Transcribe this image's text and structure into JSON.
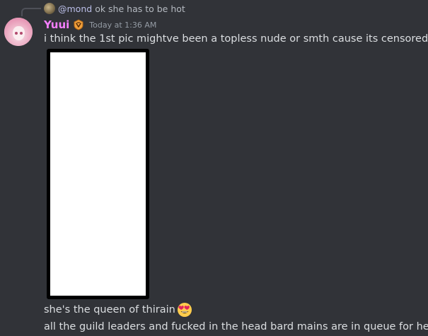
{
  "reply": {
    "mention": "@mond",
    "text": "ok she has to be hot"
  },
  "message": {
    "username": "Yuui",
    "timestamp": "Today at 1:36 AM",
    "username_color": "#f47fff",
    "badge_icon": "hype-squad-badge-icon",
    "lines": [
      "i think the 1st pic mightve been a topless nude or smth cause its censored",
      "she's the queen of thirain",
      "all the guild leaders and fucked in the head bard mains are in queue for her"
    ],
    "emoji": "heart-eyes-emoji-icon"
  },
  "colors": {
    "background": "#313338",
    "text": "#dbdee1",
    "muted": "#949ba4"
  }
}
